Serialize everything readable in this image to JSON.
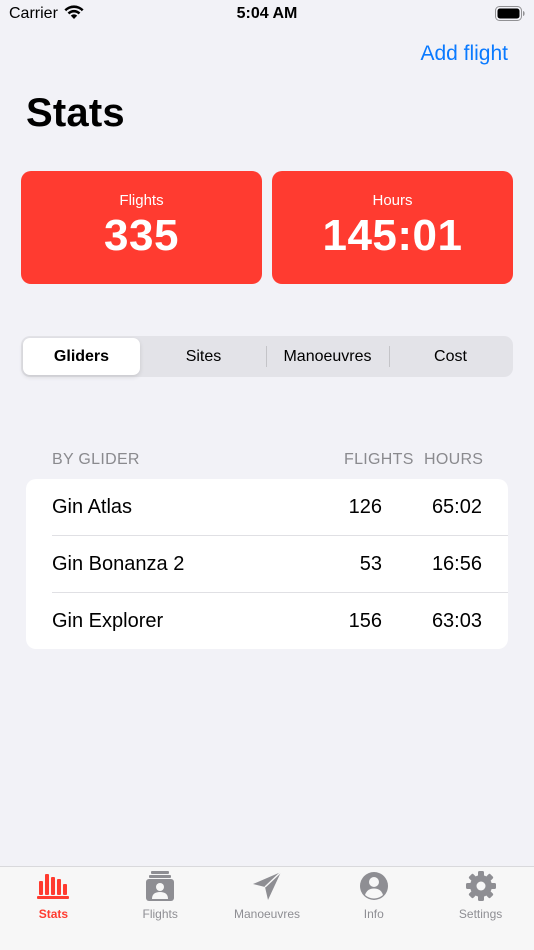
{
  "status_bar": {
    "carrier": "Carrier",
    "time": "5:04 AM"
  },
  "nav": {
    "action_label": "Add flight",
    "title": "Stats"
  },
  "summary": {
    "flights": {
      "label": "Flights",
      "value": "335"
    },
    "hours": {
      "label": "Hours",
      "value": "145:01"
    }
  },
  "segments": [
    {
      "label": "Gliders",
      "active": true
    },
    {
      "label": "Sites",
      "active": false
    },
    {
      "label": "Manoeuvres",
      "active": false
    },
    {
      "label": "Cost",
      "active": false
    }
  ],
  "table": {
    "group_header": "BY GLIDER",
    "flights_header": "FLIGHTS",
    "hours_header": "HOURS",
    "rows": [
      {
        "name": "Gin Atlas",
        "flights": "126",
        "hours": "65:02"
      },
      {
        "name": "Gin Bonanza 2",
        "flights": "53",
        "hours": "16:56"
      },
      {
        "name": "Gin Explorer",
        "flights": "156",
        "hours": "63:03"
      }
    ]
  },
  "tabs": [
    {
      "label": "Stats",
      "icon": "bar-chart-icon",
      "active": true
    },
    {
      "label": "Flights",
      "icon": "logbook-icon",
      "active": false
    },
    {
      "label": "Manoeuvres",
      "icon": "paper-plane-icon",
      "active": false
    },
    {
      "label": "Info",
      "icon": "person-circle-icon",
      "active": false
    },
    {
      "label": "Settings",
      "icon": "gear-icon",
      "active": false
    }
  ],
  "colors": {
    "accent": "#ff3b30",
    "link": "#0a7aff",
    "background": "#f2f2f7",
    "inactive": "#8e8e93"
  }
}
